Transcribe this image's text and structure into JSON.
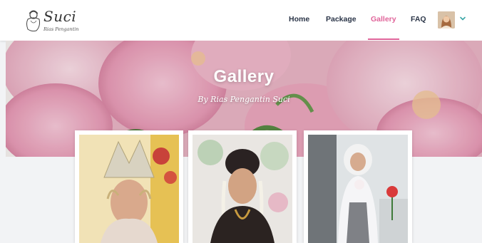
{
  "brand": {
    "name": "Suci",
    "tagline": "Rias Pengantin"
  },
  "nav": {
    "items": [
      {
        "label": "Home",
        "active": false
      },
      {
        "label": "Package",
        "active": false
      },
      {
        "label": "Gallery",
        "active": true
      },
      {
        "label": "FAQ",
        "active": false
      }
    ],
    "active_color": "#e0649a",
    "text_color": "#2b3548"
  },
  "hero": {
    "title": "Gallery",
    "subtitle": "By Rias Pengantin Suci"
  },
  "gallery": [
    {
      "name": "gallery-photo-1"
    },
    {
      "name": "gallery-photo-2"
    },
    {
      "name": "gallery-photo-3"
    }
  ],
  "icons": {
    "user_menu": "chevron-down-icon",
    "avatar": "avatar"
  }
}
